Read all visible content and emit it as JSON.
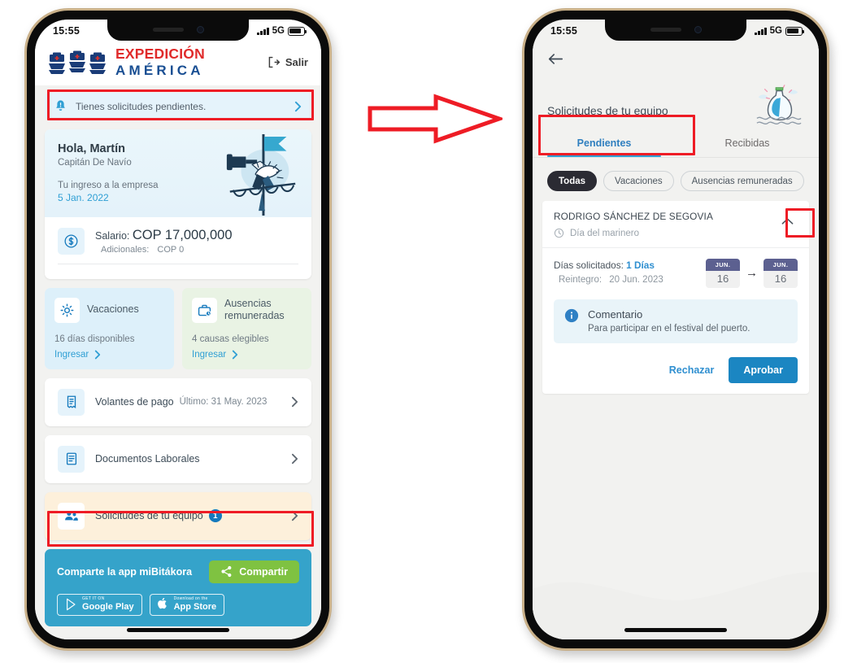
{
  "annotation": {
    "arrow_color": "#ee1c25",
    "highlight_color": "#ee1c25",
    "arrow_name": "flow-arrow"
  },
  "phone_left": {
    "status_bar": {
      "time": "15:55",
      "network": "5G"
    },
    "header": {
      "brand_line1": "EXPEDICIÓN",
      "brand_line2": "AMÉRICA",
      "logout_label": "Salir",
      "logo_name": "three-ships-logo"
    },
    "alert": {
      "text": "Tienes solicitudes pendientes.",
      "icon": "bell-icon"
    },
    "hero": {
      "greeting": "Hola, Martín",
      "role": "Capitán De Navío",
      "start_label": "Tu ingreso a la empresa",
      "start_date": "5 Jan. 2022",
      "illustration": "sailor-with-telescope-illustration"
    },
    "salary": {
      "icon": "dollar-circle-icon",
      "label": "Salario:",
      "amount": "COP 17,000,000",
      "extra_label": "Adicionales:",
      "extra_amount": "COP 0"
    },
    "tiles": [
      {
        "title": "Vacaciones",
        "icon": "sun-icon",
        "sub": "16 días disponibles",
        "link": "Ingresar",
        "color": "#ddf0fa"
      },
      {
        "title": "Ausencias remuneradas",
        "icon": "briefcase-clock-icon",
        "sub": "4 causas elegibles",
        "link": "Ingresar",
        "color": "#e9f3e4"
      }
    ],
    "rows": [
      {
        "label": "Volantes de pago",
        "meta": "Último: 31 May. 2023",
        "icon": "payslip-icon",
        "badge": ""
      },
      {
        "label": "Documentos Laborales",
        "meta": "",
        "icon": "document-icon",
        "badge": ""
      },
      {
        "label": "Solicitudes de tu equipo",
        "meta": "",
        "icon": "team-icon",
        "badge": "1"
      }
    ],
    "share": {
      "title": "Comparte la app miBitákora",
      "button": "Compartir",
      "button_icon": "share-icon",
      "stores": [
        {
          "small": "GET IT ON",
          "big": "Google Play",
          "icon": "google-play-icon"
        },
        {
          "small": "Download on the",
          "big": "App Store",
          "icon": "apple-icon"
        }
      ]
    }
  },
  "phone_right": {
    "status_bar": {
      "time": "15:55",
      "network": "5G"
    },
    "back_icon": "back-arrow-icon",
    "title": "Solicitudes de tu equipo",
    "illustration": "message-in-bottle-illustration",
    "tabs": [
      {
        "label": "Pendientes",
        "active": true
      },
      {
        "label": "Recibidas",
        "active": false
      }
    ],
    "filters": [
      {
        "label": "Todas",
        "active": true
      },
      {
        "label": "Vacaciones",
        "active": false
      },
      {
        "label": "Ausencias remuneradas",
        "active": false
      }
    ],
    "request": {
      "employee": "RODRIGO SÁNCHEZ DE SEGOVIA",
      "type": "Día del marinero",
      "type_icon": "clock-icon",
      "collapse_icon": "chevron-up-icon",
      "days_label": "Días solicitados:",
      "days_value": "1 Días",
      "return_label": "Reintegro:",
      "return_value": "20 Jun. 2023",
      "date_from": {
        "month": "JUN.",
        "day": "16"
      },
      "date_to": {
        "month": "JUN.",
        "day": "16"
      },
      "arrow": "→",
      "comment_title": "Comentario",
      "comment_icon": "info-icon",
      "comment_text": "Para participar en el festival del puerto.",
      "reject_label": "Rechazar",
      "approve_label": "Aprobar"
    }
  }
}
